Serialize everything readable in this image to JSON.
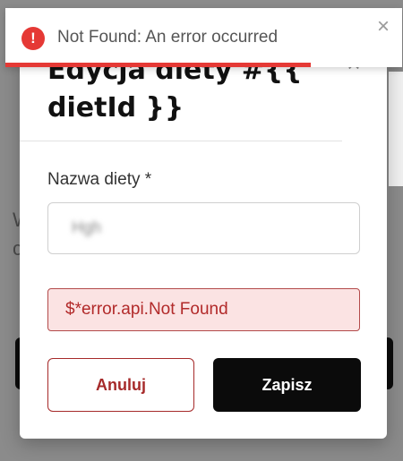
{
  "toast": {
    "icon": "error-exclamation-icon",
    "icon_glyph": "!",
    "message": "Not Found: An error occurred",
    "close_glyph": "×",
    "progress_percent": 77,
    "color": "#e53935"
  },
  "modal": {
    "title": "Edycja diety #{{ dietId }}",
    "close_glyph": "×",
    "field": {
      "label": "Nazwa diety *",
      "value": "Hgh"
    },
    "error_message": "$*error.api.Not Found",
    "cancel_label": "Anuluj",
    "save_label": "Zapisz"
  },
  "background": {
    "letters": [
      "W",
      "c"
    ]
  },
  "colors": {
    "accent_red": "#a62a2a",
    "error_bg": "#fbe3e3",
    "primary_button": "#0b0b0b"
  }
}
